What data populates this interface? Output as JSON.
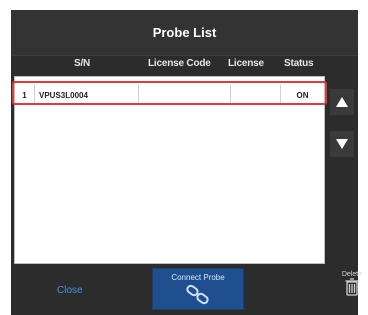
{
  "dialog": {
    "title": "Probe List"
  },
  "table": {
    "columns": [
      "S/N",
      "License Code",
      "License",
      "Status"
    ],
    "rows": [
      {
        "index": "1",
        "sn": "VPUS3L0004",
        "license_code": "",
        "license": "",
        "status": "ON"
      }
    ]
  },
  "buttons": {
    "close_label": "Close",
    "connect_label": "Connect Probe",
    "delete_label": "Delete",
    "scroll_up_icon": "triangle-up-icon",
    "scroll_down_icon": "triangle-down-icon"
  },
  "colors": {
    "background": "#2c2c2c",
    "selection_border": "#e03a3a",
    "accent_blue": "#4a90d9",
    "connect_button": "#1f4f8f"
  }
}
